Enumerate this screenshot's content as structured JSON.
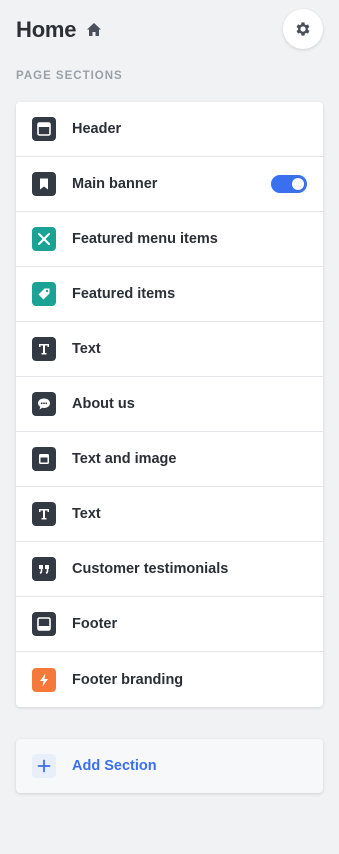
{
  "header": {
    "title": "Home",
    "home_icon": "home-icon",
    "settings_icon": "gear-icon"
  },
  "sections_heading": "PAGE SECTIONS",
  "colors": {
    "dark_icon_bg": "#333a44",
    "teal_icon_bg": "#1aa394",
    "orange_icon_bg": "#f5793a",
    "accent_blue": "#3a6ff0"
  },
  "sections": [
    {
      "label": "Header",
      "icon": "header-layout-icon",
      "icon_color": "#333a44"
    },
    {
      "label": "Main banner",
      "icon": "bookmark-icon",
      "icon_color": "#333a44",
      "toggle_on": true
    },
    {
      "label": "Featured menu items",
      "icon": "utensils-icon",
      "icon_color": "#1aa394"
    },
    {
      "label": "Featured items",
      "icon": "tag-icon",
      "icon_color": "#1aa394"
    },
    {
      "label": "Text",
      "icon": "text-icon",
      "icon_color": "#333a44"
    },
    {
      "label": "About us",
      "icon": "chat-bubble-icon",
      "icon_color": "#333a44"
    },
    {
      "label": "Text and image",
      "icon": "text-image-icon",
      "icon_color": "#333a44"
    },
    {
      "label": "Text",
      "icon": "text-icon",
      "icon_color": "#333a44"
    },
    {
      "label": "Customer testimonials",
      "icon": "quote-icon",
      "icon_color": "#333a44"
    },
    {
      "label": "Footer",
      "icon": "footer-layout-icon",
      "icon_color": "#333a44"
    },
    {
      "label": "Footer branding",
      "icon": "lightning-icon",
      "icon_color": "#f5793a"
    }
  ],
  "add_section": {
    "label": "Add Section",
    "icon": "plus-icon"
  }
}
